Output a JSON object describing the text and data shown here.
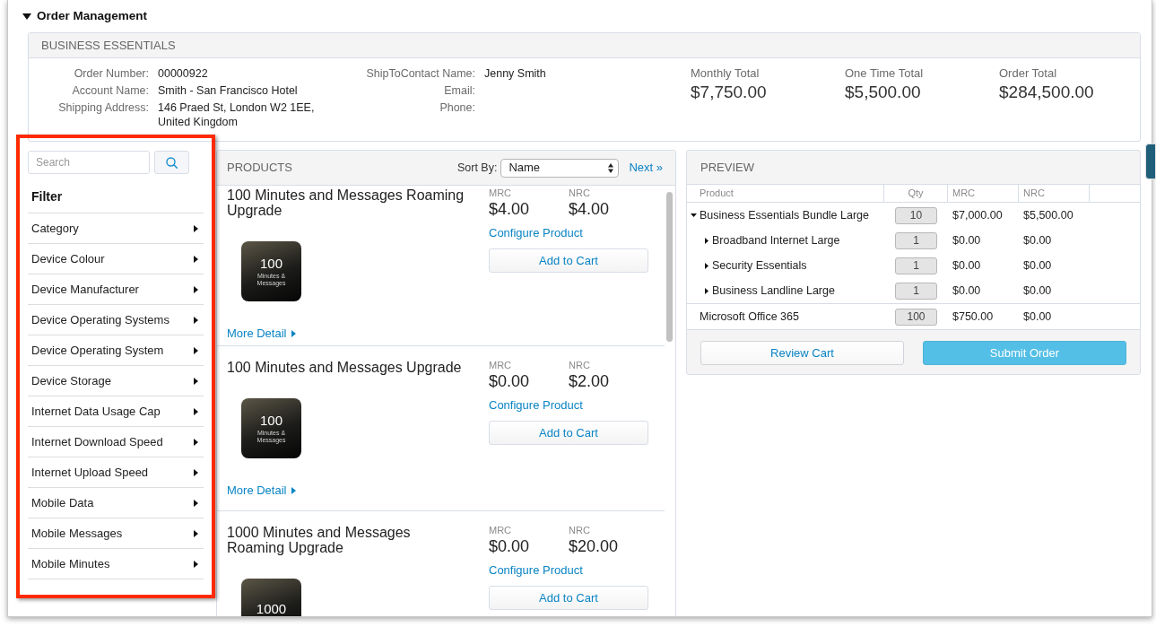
{
  "section": {
    "title": "Order Management",
    "expanded": true
  },
  "summary": {
    "title": "BUSINESS ESSENTIALS",
    "fields": [
      {
        "label": "Order Number:",
        "value": "00000922"
      },
      {
        "label": "Account Name:",
        "value": "Smith - San Francisco Hotel"
      },
      {
        "label": "Shipping Address:",
        "value": "146 Praed St, London W2 1EE, United Kingdom"
      }
    ],
    "contact_fields": [
      {
        "label": "ShipToContact Name:",
        "value": "Jenny Smith"
      },
      {
        "label": "Email:"
      },
      {
        "label": "Phone:"
      }
    ],
    "totals": [
      {
        "label": "Monthly Total",
        "value": "$7,750.00"
      },
      {
        "label": "One Time Total",
        "value": "$5,500.00"
      },
      {
        "label": "Order Total",
        "value": "$284,500.00"
      }
    ]
  },
  "filter": {
    "highlighted": true,
    "search": {
      "placeholder": "Search"
    },
    "title": "Filter",
    "items": [
      {
        "label": "Category",
        "expanded": false
      },
      {
        "label": "Device Colour",
        "expanded": false
      },
      {
        "label": "Device Manufacturer",
        "expanded": false
      },
      {
        "label": "Device Operating Systems",
        "expanded": false
      },
      {
        "label": "Device Operating System",
        "expanded": false
      },
      {
        "label": "Device Storage",
        "expanded": false
      },
      {
        "label": "Internet Data Usage Cap",
        "expanded": false
      },
      {
        "label": "Internet Download Speed",
        "expanded": false
      },
      {
        "label": "Internet Upload Speed",
        "expanded": false
      },
      {
        "label": "Mobile Data",
        "expanded": false
      },
      {
        "label": "Mobile Messages",
        "expanded": false
      },
      {
        "label": "Mobile Minutes",
        "expanded": false
      }
    ]
  },
  "products": {
    "title": "PRODUCTS",
    "sort_label": "Sort By:",
    "sort_value": "Name",
    "next_link": "Next »",
    "items": [
      {
        "title": "100 Minutes and Messages Roaming Upgrade",
        "mrc_label": "MRC",
        "mrc": "$4.00",
        "nrc_label": "NRC",
        "nrc": "$4.00",
        "configure_link": "Configure Product",
        "add_button": "Add to Cart",
        "image": {
          "number": "100",
          "caption": "Minutes & Messages"
        },
        "more_link": "More Detail"
      },
      {
        "title": "100 Minutes and Messages Upgrade",
        "mrc_label": "MRC",
        "mrc": "$0.00",
        "nrc_label": "NRC",
        "nrc": "$2.00",
        "configure_link": "Configure Product",
        "add_button": "Add to Cart",
        "image": {
          "number": "100",
          "caption": "Minutes & Messages"
        },
        "more_link": "More Detail"
      },
      {
        "title": "1000 Minutes and Messages Roaming Upgrade",
        "mrc_label": "MRC",
        "mrc": "$0.00",
        "nrc_label": "NRC",
        "nrc": "$20.00",
        "configure_link": "Configure Product",
        "add_button": "Add to Cart",
        "image": {
          "number": "1000"
        }
      }
    ]
  },
  "preview": {
    "title": "PREVIEW",
    "columns": [
      "Product",
      "Qty",
      "MRC",
      "NRC"
    ],
    "rows": [
      {
        "product": "Business Essentials Bundle Large",
        "qty": "10",
        "mrc": "$7,000.00",
        "nrc": "$5,500.00",
        "expanded": true,
        "children": [
          {
            "product": "Broadband Internet Large",
            "qty": "1",
            "mrc": "$0.00",
            "nrc": "$0.00",
            "expanded": false
          },
          {
            "product": "Security Essentials",
            "qty": "1",
            "mrc": "$0.00",
            "nrc": "$0.00",
            "expanded": false
          },
          {
            "product": "Business Landline Large",
            "qty": "1",
            "mrc": "$0.00",
            "nrc": "$0.00",
            "expanded": false
          }
        ]
      },
      {
        "product": "Microsoft Office 365",
        "qty": "100",
        "mrc": "$750.00",
        "nrc": "$0.00"
      }
    ],
    "buttons": [
      {
        "label": "Review Cart",
        "kind": "secondary"
      },
      {
        "label": "Submit Order",
        "kind": "primary"
      }
    ]
  }
}
